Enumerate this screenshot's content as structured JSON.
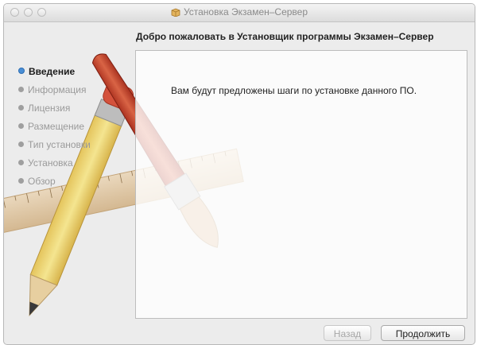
{
  "window": {
    "title": "Установка Экзамен–Сервер"
  },
  "header": {
    "heading": "Добро пожаловать в Установщик программы Экзамен–Сервер"
  },
  "sidebar": {
    "steps": [
      {
        "label": "Введение",
        "active": true
      },
      {
        "label": "Информация",
        "active": false
      },
      {
        "label": "Лицензия",
        "active": false
      },
      {
        "label": "Размещение",
        "active": false
      },
      {
        "label": "Тип установки",
        "active": false
      },
      {
        "label": "Установка",
        "active": false
      },
      {
        "label": "Обзор",
        "active": false
      }
    ]
  },
  "main": {
    "text": "Вам будут предложены шаги по установке данного ПО."
  },
  "buttons": {
    "back_label": "Назад",
    "continue_label": "Продолжить"
  },
  "colors": {
    "active_step": "#4a8fd6",
    "window_bg": "#ececec"
  },
  "icons": {
    "title_icon": "installer-package-icon",
    "background": "pencil-brush-ruler-artwork"
  }
}
